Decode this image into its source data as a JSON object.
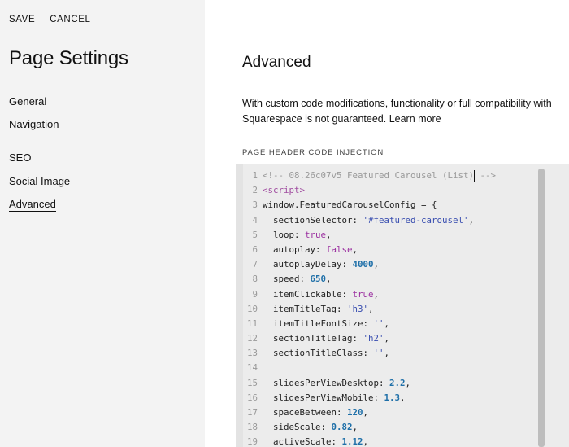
{
  "sidebar": {
    "save_label": "SAVE",
    "cancel_label": "CANCEL",
    "title": "Page Settings",
    "items": [
      {
        "label": "General"
      },
      {
        "label": "Navigation"
      },
      {
        "label": "SEO"
      },
      {
        "label": "Social Image"
      },
      {
        "label": "Advanced"
      }
    ]
  },
  "main": {
    "title": "Advanced",
    "description_line1": "With custom code modifications, functionality or full compatibility with",
    "description_line2": "Squarespace is not guaranteed.",
    "learn_more": "Learn more",
    "section_label": "PAGE HEADER CODE INJECTION"
  },
  "code": {
    "lines": [
      {
        "n": "1",
        "t": "<!-- 08.26c07v5 Featured Carousel (List)"
      },
      {
        "n": "2",
        "t": "<script>"
      },
      {
        "n": "3",
        "t": "window.FeaturedCarouselConfig = {"
      },
      {
        "n": "4",
        "t": "  sectionSelector: '#featured-carousel',"
      },
      {
        "n": "5",
        "t": "  loop: true,"
      },
      {
        "n": "6",
        "t": "  autoplay: false,"
      },
      {
        "n": "7",
        "t": "  autoplayDelay: 4000,"
      },
      {
        "n": "8",
        "t": "  speed: 650,"
      },
      {
        "n": "9",
        "t": "  itemClickable: true,"
      },
      {
        "n": "10",
        "t": "  itemTitleTag: 'h3',"
      },
      {
        "n": "11",
        "t": "  itemTitleFontSize: '',"
      },
      {
        "n": "12",
        "t": "  sectionTitleTag: 'h2',"
      },
      {
        "n": "13",
        "t": "  sectionTitleClass: '',"
      },
      {
        "n": "14",
        "t": ""
      },
      {
        "n": "15",
        "t": "  slidesPerViewDesktop: 2.2,"
      },
      {
        "n": "16",
        "t": "  slidesPerViewMobile: 1.3,"
      },
      {
        "n": "17",
        "t": "  spaceBetween: 120,"
      },
      {
        "n": "18",
        "t": "  sideScale: 0.82,"
      },
      {
        "n": "19",
        "t": "  activeScale: 1.12,"
      }
    ],
    "line1_tail": " -->"
  }
}
